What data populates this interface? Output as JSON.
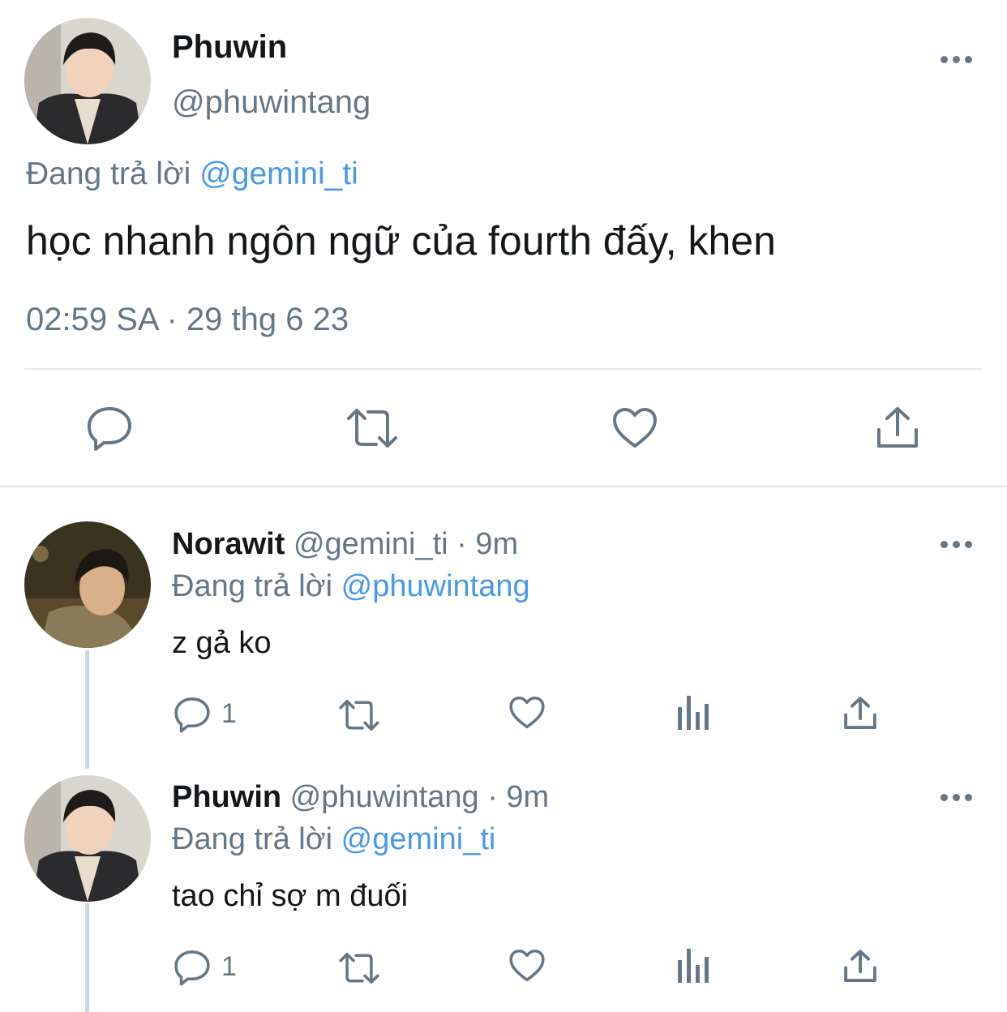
{
  "main_tweet": {
    "display_name": "Phuwin",
    "handle": "@phuwintang",
    "replying_prefix": "Đang trả lời",
    "replying_to": "@gemini_ti",
    "text": "học nhanh ngôn ngữ của fourth đấy, khen",
    "timestamp": "02:59 SA · 29 thg 6 23"
  },
  "replies": [
    {
      "display_name": "Norawit",
      "handle": "@gemini_ti",
      "time": "· 9m",
      "replying_prefix": "Đang trả lời",
      "replying_to": "@phuwintang",
      "text": "z gả ko",
      "reply_count": "1"
    },
    {
      "display_name": "Phuwin",
      "handle": "@phuwintang",
      "time": "· 9m",
      "replying_prefix": "Đang trả lời",
      "replying_to": "@gemini_ti",
      "text": "tao chỉ sợ m đuối",
      "reply_count": "1"
    }
  ],
  "icons": [
    "more-icon",
    "reply-icon",
    "retweet-icon",
    "like-icon",
    "share-icon",
    "analytics-icon"
  ],
  "colors": {
    "link": "#4a99e9",
    "secondary": "#657786",
    "text": "#14171a",
    "divider": "#e6ecf0"
  }
}
